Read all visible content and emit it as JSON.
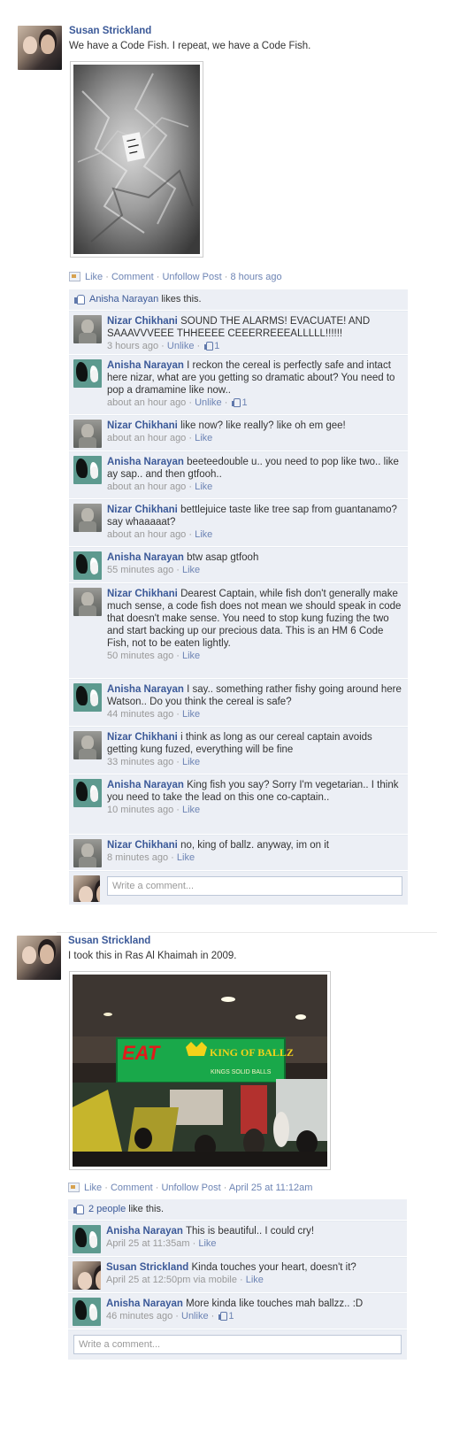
{
  "posts": [
    {
      "author": "Susan Strickland",
      "text": "We have a Code Fish. I repeat, we have a Code Fish.",
      "photo": "foil-wrapped fish",
      "actions": {
        "like": "Like",
        "comment": "Comment",
        "unfollow": "Unfollow Post",
        "time": "8 hours ago"
      },
      "likes": {
        "who": "Anisha Narayan",
        "suffix": "likes this."
      },
      "comments": [
        {
          "who": "Nizar Chikhani",
          "text": "SOUND THE ALARMS! EVACUATE! AND SAAAVVVEEE THHEEEE CEEERREEEALLLLL!!!!!!",
          "time": "3 hours ago",
          "action": "Unlike",
          "likes": "1"
        },
        {
          "who": "Anisha Narayan",
          "text": "I reckon the cereal is perfectly safe and intact here nizar, what are you getting so dramatic about? You need to pop a dramamine like now..",
          "time": "about an hour ago",
          "action": "Unlike",
          "likes": "1"
        },
        {
          "who": "Nizar Chikhani",
          "text": "like now? like really? like oh em gee!",
          "time": "about an hour ago",
          "action": "Like"
        },
        {
          "who": "Anisha Narayan",
          "text": "beeteedouble u.. you need to pop like two.. like ay sap.. and then gtfooh..",
          "time": "about an hour ago",
          "action": "Like"
        },
        {
          "who": "Nizar Chikhani",
          "text": "bettlejuice taste like tree sap from guantanamo? say whaaaaat?",
          "time": "about an hour ago",
          "action": "Like"
        },
        {
          "who": "Anisha Narayan",
          "text": "btw asap gtfooh",
          "time": "55 minutes ago",
          "action": "Like"
        },
        {
          "who": "Nizar Chikhani",
          "text": "Dearest Captain, while fish don't generally make much sense, a code fish does not mean we should speak in code that doesn't make sense. You need to stop kung fuzing the two and start backing up our precious data. This is an HM 6 Code Fish, not to be eaten lightly.",
          "time": "50 minutes ago",
          "action": "Like"
        },
        {
          "who": "Anisha Narayan",
          "text": "I say.. something rather fishy going around here Watson.. Do you think the cereal is safe?",
          "time": "44 minutes ago",
          "action": "Like"
        },
        {
          "who": "Nizar Chikhani",
          "text": "i think as long as our cereal captain avoids getting kung fuzed, everything will be fine",
          "time": "33 minutes ago",
          "action": "Like"
        },
        {
          "who": "Anisha Narayan",
          "text": "King fish you say? Sorry I'm vegetarian.. I think you need to take the lead on this one co-captain..",
          "time": "10 minutes ago",
          "action": "Like"
        },
        {
          "who": "Nizar Chikhani",
          "text": "no, king of ballz. anyway, im on it",
          "time": "8 minutes ago",
          "action": "Like"
        }
      ],
      "write_placeholder": "Write a comment..."
    },
    {
      "author": "Susan Strickland",
      "text": "I took this in Ras Al Khaimah in 2009.",
      "photo": "food court sign",
      "sign": {
        "eat": "EAT",
        "king": "KING OF BALLZ",
        "sub": "KINGS  SOLID BALLS"
      },
      "actions": {
        "like": "Like",
        "comment": "Comment",
        "unfollow": "Unfollow Post",
        "time": "April 25 at 11:12am"
      },
      "likes": {
        "who": "2 people",
        "suffix": "like this."
      },
      "comments": [
        {
          "who": "Anisha Narayan",
          "text": "This is beautiful.. I could cry!",
          "time": "April 25 at 11:35am",
          "action": "Like"
        },
        {
          "who": "Susan Strickland",
          "text": "Kinda touches your heart, doesn't it?",
          "time": "April 25 at 12:50pm via mobile",
          "action": "Like"
        },
        {
          "who": "Anisha Narayan",
          "text": "More kinda like touches mah ballzz.. :D",
          "time": "46 minutes ago",
          "action": "Unlike",
          "likes": "1"
        }
      ],
      "write_placeholder": "Write a comment..."
    }
  ],
  "sep": " · ",
  "icons": [
    "like-thumb-icon",
    "story-action-icon"
  ]
}
